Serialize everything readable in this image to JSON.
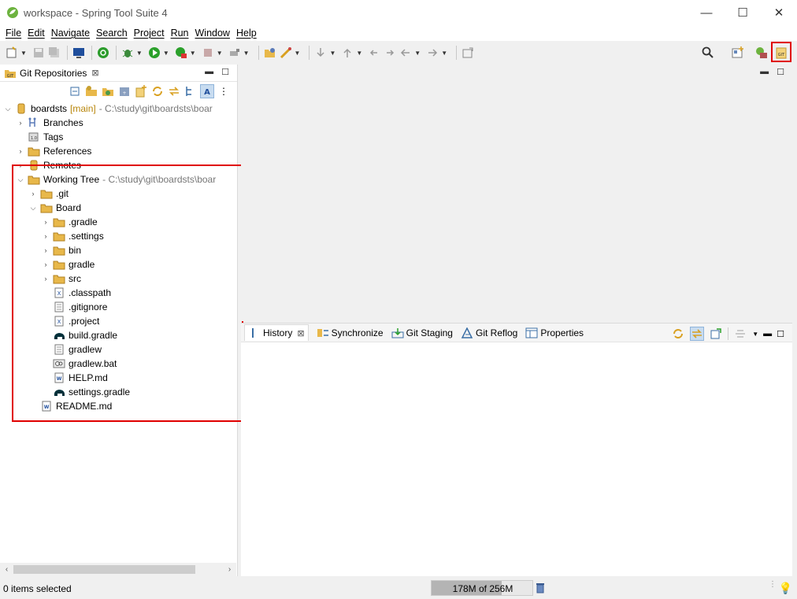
{
  "window": {
    "title": "workspace - Spring Tool Suite 4",
    "minimize": "—",
    "maximize": "☐",
    "close": "✕"
  },
  "menu": [
    "File",
    "Edit",
    "Navigate",
    "Search",
    "Project",
    "Run",
    "Window",
    "Help"
  ],
  "git_repos_view": {
    "title": "Git Repositories",
    "close_icon": "⊠",
    "repo": {
      "name": "boardsts",
      "branch": "[main]",
      "path": "- C:\\study\\git\\boardsts\\boar",
      "children": [
        "Branches",
        "Tags",
        "References",
        "Remotes"
      ]
    },
    "working_tree": {
      "label": "Working Tree",
      "path": "- C:\\study\\git\\boardsts\\boar",
      "git_folder": ".git",
      "board": {
        "label": "Board",
        "folders": [
          ".gradle",
          ".settings",
          "bin",
          "gradle",
          "src"
        ],
        "files": [
          ".classpath",
          ".gitignore",
          ".project",
          "build.gradle",
          "gradlew",
          "gradlew.bat",
          "HELP.md",
          "settings.gradle"
        ]
      },
      "readme": "README.md"
    }
  },
  "bottom_tabs": [
    "History",
    "Synchronize",
    "Git Staging",
    "Git Reflog",
    "Properties"
  ],
  "status": {
    "selection": "0 items selected",
    "heap": "178M of 256M",
    "heap_fraction": 0.695
  }
}
